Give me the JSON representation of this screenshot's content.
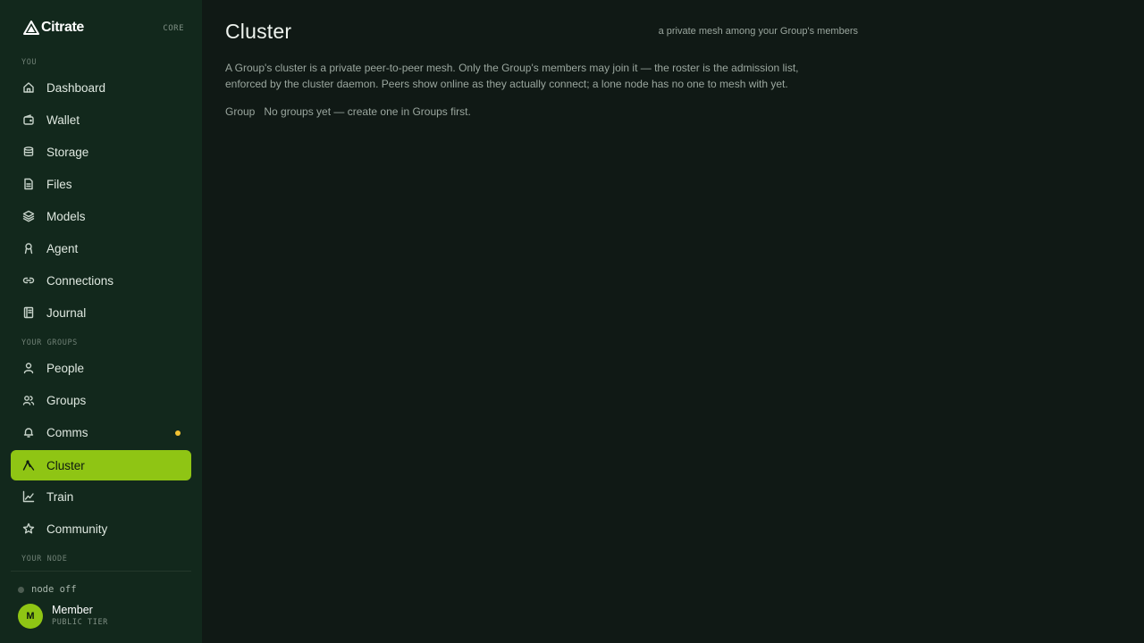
{
  "brand": {
    "name": "Citrate",
    "tag": "CORE"
  },
  "sidebar": {
    "sections": {
      "you": "YOU",
      "groups": "YOUR GROUPS",
      "node": "YOUR NODE"
    },
    "you_items": [
      {
        "label": "Dashboard",
        "icon": "home-icon"
      },
      {
        "label": "Wallet",
        "icon": "wallet-icon"
      },
      {
        "label": "Storage",
        "icon": "database-icon"
      },
      {
        "label": "Files",
        "icon": "file-icon"
      },
      {
        "label": "Models",
        "icon": "layers-icon"
      },
      {
        "label": "Agent",
        "icon": "agent-icon"
      },
      {
        "label": "Connections",
        "icon": "link-icon"
      },
      {
        "label": "Journal",
        "icon": "journal-icon"
      }
    ],
    "group_items": [
      {
        "label": "People",
        "icon": "person-icon"
      },
      {
        "label": "Groups",
        "icon": "users-icon"
      },
      {
        "label": "Comms",
        "icon": "bell-icon",
        "badge": true
      },
      {
        "label": "Cluster",
        "icon": "cluster-icon",
        "active": true
      },
      {
        "label": "Train",
        "icon": "chart-line-icon"
      },
      {
        "label": "Community",
        "icon": "star-icon"
      }
    ],
    "node_status": "node off",
    "user": {
      "initial": "M",
      "name": "Member",
      "tier": "PUBLIC TIER"
    }
  },
  "main": {
    "title": "Cluster",
    "subtitle": "a private mesh among your Group's members",
    "description": "A Group's cluster is a private peer-to-peer mesh. Only the Group's members may join it — the roster is the admission list, enforced by the cluster daemon. Peers show online as they actually connect; a lone node has no one to mesh with yet.",
    "group_label": "Group",
    "group_empty": "No groups yet — create one in Groups first."
  },
  "colors": {
    "accent": "#8fc514",
    "sidebar_bg": "#12281c",
    "main_bg": "#101915",
    "badge": "#f2c233"
  }
}
